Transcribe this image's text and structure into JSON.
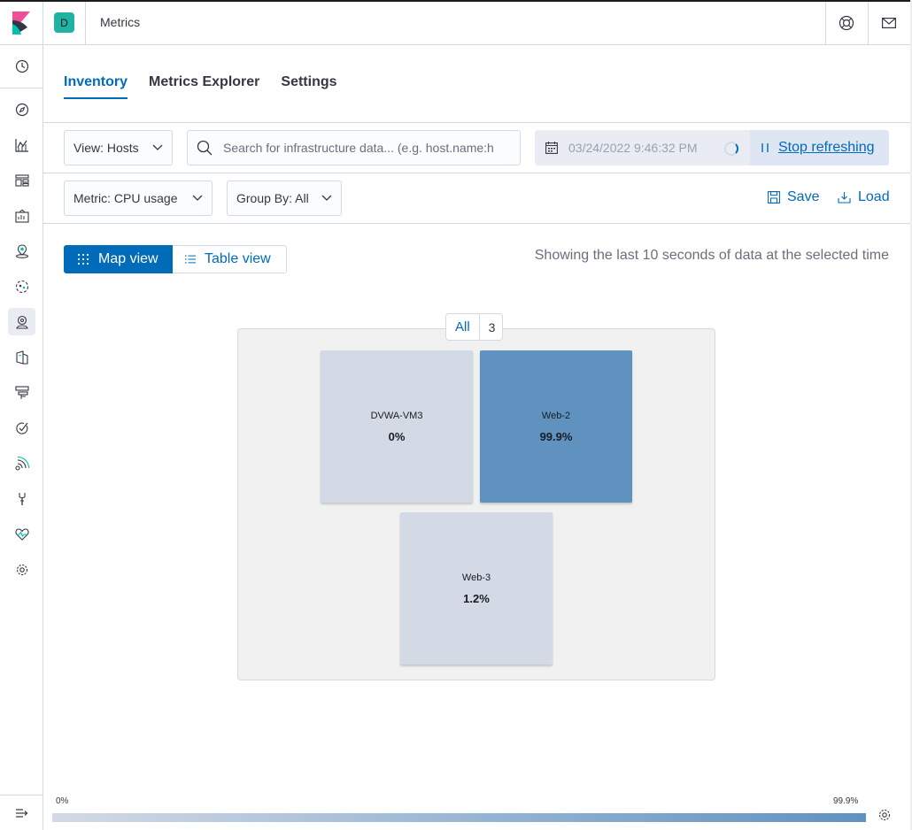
{
  "header": {
    "space_initial": "D",
    "breadcrumb": "Metrics",
    "help_icon": "help-lifebuoy-icon",
    "newsfeed_icon": "mail-icon"
  },
  "sidenav": {
    "items": [
      {
        "name": "recent-clock-icon"
      },
      {
        "name": "discover-compass-icon"
      },
      {
        "name": "visualize-chart-icon"
      },
      {
        "name": "dashboard-icon"
      },
      {
        "name": "canvas-icon"
      },
      {
        "name": "maps-icon"
      },
      {
        "name": "machine-learning-icon"
      },
      {
        "name": "metrics-icon",
        "active": true
      },
      {
        "name": "logs-icon"
      },
      {
        "name": "apm-icon"
      },
      {
        "name": "uptime-icon"
      },
      {
        "name": "siem-icon"
      },
      {
        "name": "dev-tools-icon"
      },
      {
        "name": "monitoring-icon"
      },
      {
        "name": "management-gear-icon"
      }
    ],
    "collapse_icon": "collapse-menu-icon"
  },
  "tabs": [
    {
      "label": "Inventory",
      "selected": true
    },
    {
      "label": "Metrics Explorer",
      "selected": false
    },
    {
      "label": "Settings",
      "selected": false
    }
  ],
  "toolbar": {
    "view_select": "View: Hosts",
    "search_placeholder": "Search for infrastructure data... (e.g. host.name:h",
    "date": "03/24/2022 9:46:32 PM",
    "stop_refreshing": "Stop refreshing",
    "metric_select": "Metric: CPU usage",
    "group_by_select": "Group By: All",
    "save_label": "Save",
    "load_label": "Load"
  },
  "view_toggle": {
    "map_label": "Map view",
    "table_label": "Table view"
  },
  "status_text": "Showing the last 10 seconds of data at the selected time",
  "map": {
    "group_name": "All",
    "group_count": "3",
    "nodes": [
      {
        "name": "DVWA-VM3",
        "value": "0%",
        "color": "#d3dae6"
      },
      {
        "name": "Web-2",
        "value": "99.9%",
        "color": "#6092c0"
      },
      {
        "name": "Web-3",
        "value": "1.2%",
        "color": "#d3dae6"
      }
    ]
  },
  "legend": {
    "min_label": "0%",
    "max_label": "99.9%",
    "gradient_start": "#d3dae6",
    "gradient_end": "#6092c0"
  }
}
